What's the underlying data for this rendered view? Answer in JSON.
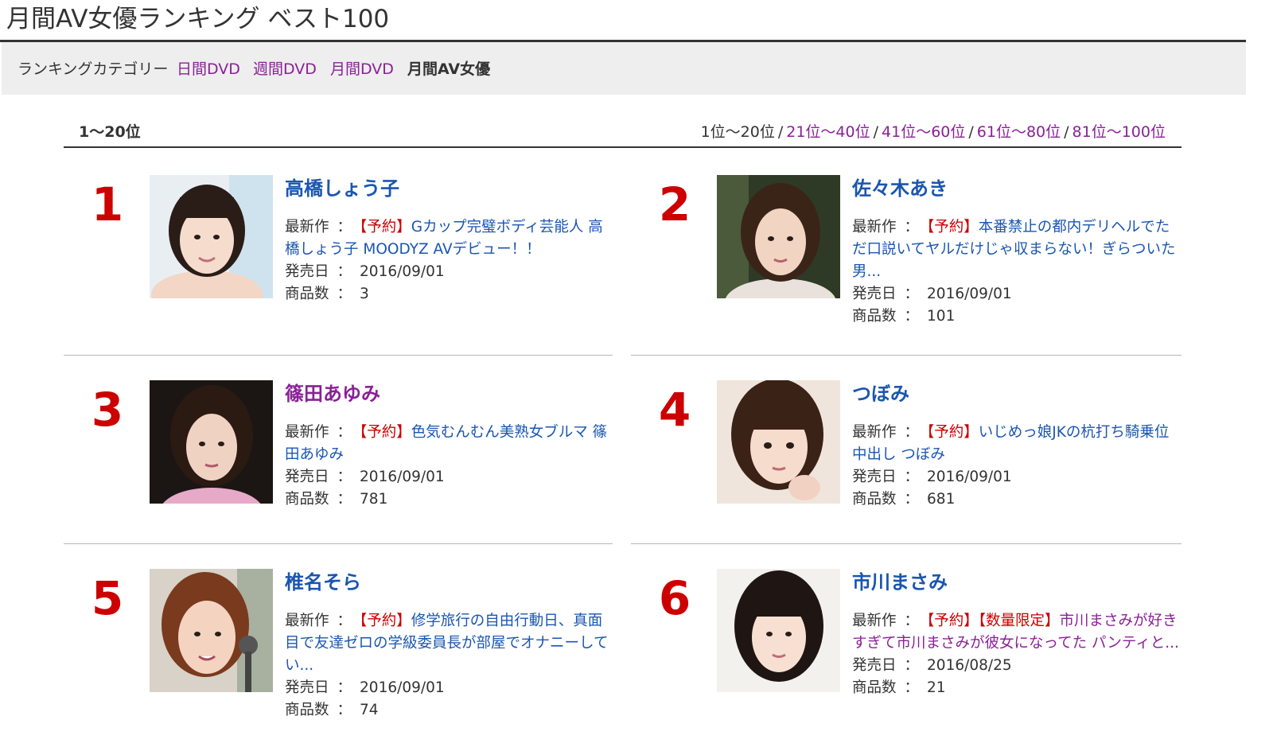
{
  "page": {
    "title": "月間AV女優ランキング ベスト100"
  },
  "category_bar": {
    "label": "ランキングカテゴリー",
    "links": [
      {
        "label": "日間DVD"
      },
      {
        "label": "週間DVD"
      },
      {
        "label": "月間DVD"
      }
    ],
    "current": "月間AV女優"
  },
  "range": {
    "current": "1〜20位",
    "pager_current": "1位〜20位",
    "pager_links": [
      "21位〜40位",
      "41位〜60位",
      "61位〜80位",
      "81位〜100位"
    ],
    "separator": "/"
  },
  "labels": {
    "latest": "最新作",
    "release": "発売日",
    "count": "商品数",
    "colon": "："
  },
  "entries": [
    {
      "rank": "1",
      "name": "高橋しょう子",
      "tag": "【予約】",
      "work": "Gカップ完璧ボディ芸能人 高橋しょう子 MOODYZ AVデビュー！！",
      "release_date": "2016/09/01",
      "count": "3"
    },
    {
      "rank": "2",
      "name": "佐々木あき",
      "tag": "【予約】",
      "work": "本番禁止の都内デリヘルでただ口説いてヤルだけじゃ収まらない！ぎらついた男...",
      "release_date": "2016/09/01",
      "count": "101"
    },
    {
      "rank": "3",
      "name": "篠田あゆみ",
      "tag": "【予約】",
      "work": "色気むんむん美熟女ブルマ 篠田あゆみ",
      "release_date": "2016/09/01",
      "count": "781"
    },
    {
      "rank": "4",
      "name": "つぼみ",
      "tag": "【予約】",
      "work": "いじめっ娘JKの杭打ち騎乗位中出し つぼみ",
      "release_date": "2016/09/01",
      "count": "681"
    },
    {
      "rank": "5",
      "name": "椎名そら",
      "tag": "【予約】",
      "work": "修学旅行の自由行動日、真面目で友達ゼロの学級委員長が部屋でオナニーしてい...",
      "release_date": "2016/09/01",
      "count": "74"
    },
    {
      "rank": "6",
      "name": "市川まさみ",
      "tag": "【予約】【数量限定】",
      "work": "市川まさみが好きすぎて市川まさみが彼女になってた パンティと...",
      "release_date": "2016/08/25",
      "count": "21"
    }
  ],
  "colors": {
    "rank": "#cc0000",
    "link_blue": "#1a56b0",
    "link_visited": "#8a2197",
    "tag": "#cc0000"
  }
}
